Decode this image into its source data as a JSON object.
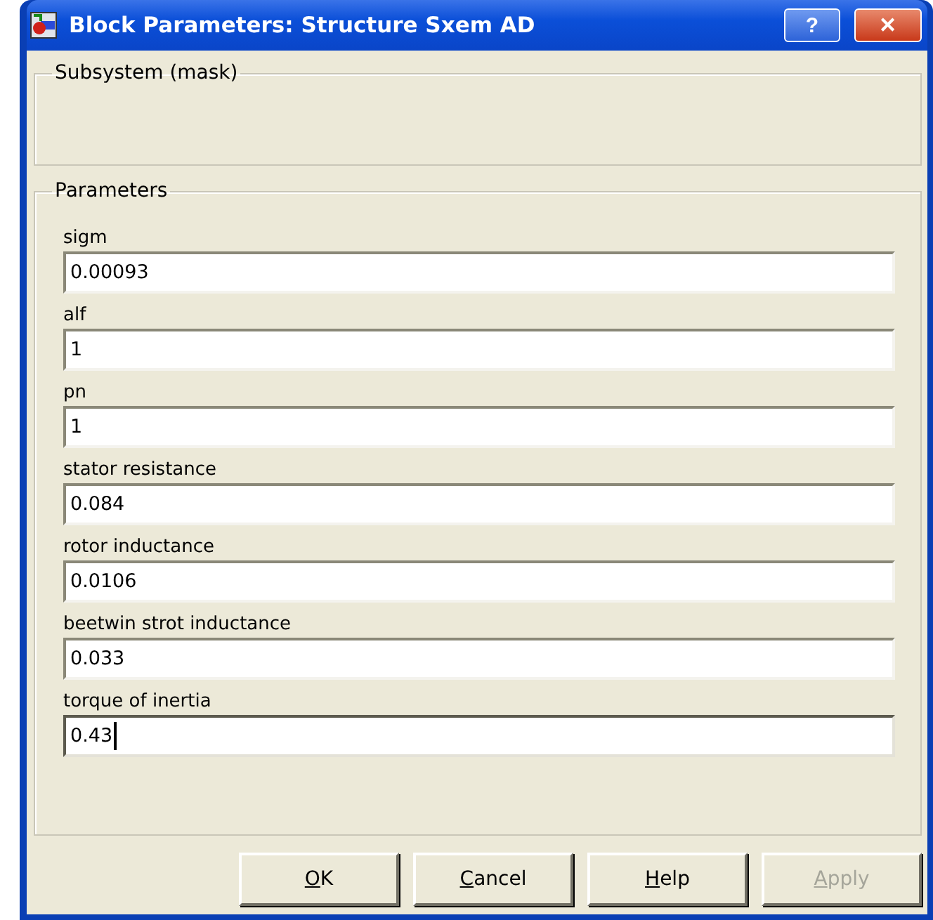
{
  "window": {
    "title": "Block Parameters: Structure Sxem AD"
  },
  "title_buttons": [
    {
      "kind": "help",
      "label": "?"
    },
    {
      "kind": "close",
      "label": "✕"
    }
  ],
  "description_group": {
    "title": "Subsystem (mask)"
  },
  "parameters_group": {
    "title": "Parameters",
    "fields": [
      {
        "label": "sigm",
        "value": "0.00093",
        "focused": false
      },
      {
        "label": "alf",
        "value": "1",
        "focused": false
      },
      {
        "label": "pn",
        "value": "1",
        "focused": false
      },
      {
        "label": "stator resistance",
        "value": "0.084",
        "focused": false
      },
      {
        "label": "rotor inductance",
        "value": "0.0106",
        "focused": false
      },
      {
        "label": "beetwin strot inductance",
        "value": "0.033",
        "focused": false
      },
      {
        "label": "torque of inertia",
        "value": "0.43",
        "focused": true
      }
    ]
  },
  "buttons": [
    {
      "label": "OK",
      "disabled": false
    },
    {
      "label": "Cancel",
      "disabled": false
    },
    {
      "label": "Help",
      "disabled": false
    },
    {
      "label": "Apply",
      "disabled": true
    }
  ]
}
